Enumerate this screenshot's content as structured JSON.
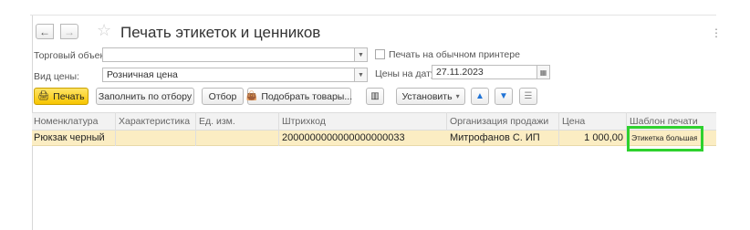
{
  "window": {
    "title": "Печать этикеток и ценников",
    "back_glyph": "←",
    "forward_glyph": "→",
    "favorite_icon": "star-outline-icon",
    "more_glyph": "⋮"
  },
  "form": {
    "trade_object_label": "Торговый объект:",
    "trade_object_value": "",
    "price_type_label": "Вид цены:",
    "price_type_value": "Розничная цена",
    "plain_printer_label": "Печать на обычном принтере",
    "plain_printer_checked": false,
    "price_date_label": "Цены на дату:",
    "price_date_value": "27.11.2023"
  },
  "toolbar": {
    "print_label": "Печать",
    "fill_by_filter_label": "Заполнить по отбору",
    "filter_label": "Отбор",
    "pick_goods_label": "Подобрать товары...",
    "set_label": "Установить",
    "dropdown_glyph": "▾",
    "up_glyph": "🡅",
    "down_glyph": "🡇"
  },
  "table": {
    "columns": [
      "Номенклатура",
      "Характеристика",
      "Ед. изм.",
      "Штрихкод",
      "Организация продажи",
      "Цена",
      "Шаблон печати"
    ],
    "rows": [
      {
        "item": "Рюкзак черный",
        "characteristic": "",
        "unit": "",
        "barcode": "2000000000000000000033",
        "organization": "Митрофанов С.  ИП",
        "price": "1 000,00",
        "template": "Этикетка большая"
      }
    ]
  },
  "colors": {
    "selected_row": "#fbedc3",
    "primary_button": "#f7c500",
    "highlight_box": "#2ed12e",
    "arrow_blue": "#1f73d6"
  }
}
